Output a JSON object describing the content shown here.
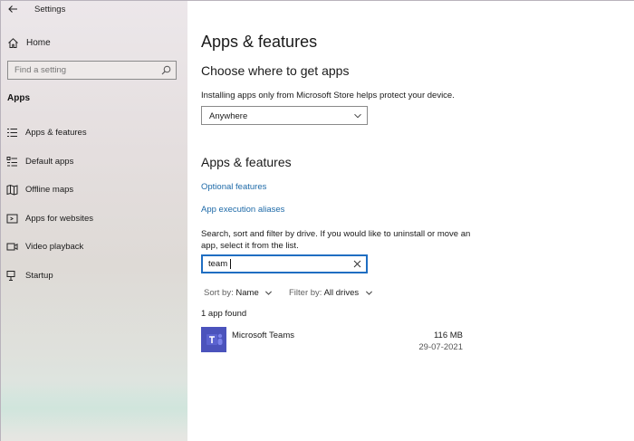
{
  "window": {
    "title": "Settings"
  },
  "sidebar": {
    "home_label": "Home",
    "search_placeholder": "Find a setting",
    "section": "Apps",
    "items": [
      {
        "label": "Apps & features",
        "icon": "list-icon"
      },
      {
        "label": "Default apps",
        "icon": "default-apps-icon"
      },
      {
        "label": "Offline maps",
        "icon": "map-icon"
      },
      {
        "label": "Apps for websites",
        "icon": "website-icon"
      },
      {
        "label": "Video playback",
        "icon": "video-icon"
      },
      {
        "label": "Startup",
        "icon": "startup-icon"
      }
    ]
  },
  "main": {
    "title": "Apps & features",
    "choose_heading": "Choose where to get apps",
    "choose_desc": "Installing apps only from Microsoft Store helps protect your device.",
    "source_dropdown": {
      "value": "Anywhere"
    },
    "features_heading": "Apps & features",
    "link_optional": "Optional features",
    "link_aliases": "App execution aliases",
    "search_desc_line1": "Search, sort and filter by drive. If you would like to uninstall or move an",
    "search_desc_line2": "app, select it from the list.",
    "search_value": "team",
    "sort_label": "Sort by:",
    "sort_value": "Name",
    "filter_label": "Filter by:",
    "filter_value": "All drives",
    "result_count": "1 app found",
    "apps": [
      {
        "name": "Microsoft Teams",
        "size": "116 MB",
        "date": "29-07-2021",
        "icon": "teams-icon"
      }
    ]
  },
  "colors": {
    "accent": "#1f6ec2",
    "link": "#1e6aa8",
    "teams": "#4b53bc"
  }
}
